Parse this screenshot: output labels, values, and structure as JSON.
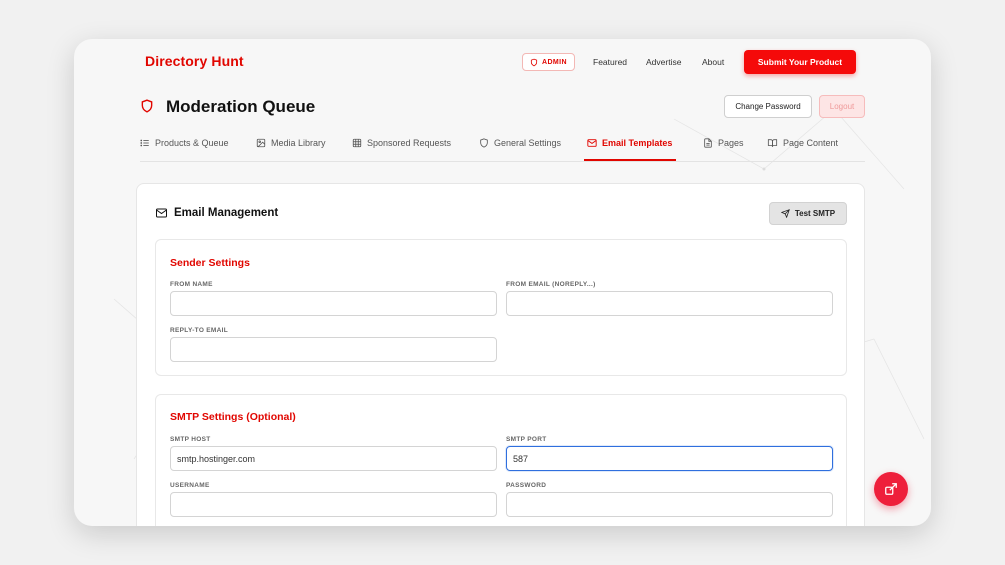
{
  "brand": "Directory Hunt",
  "nav": {
    "admin_badge": "ADMIN",
    "links": [
      "Featured",
      "Advertise",
      "About"
    ],
    "cta": "Submit Your Product"
  },
  "page": {
    "title": "Moderation Queue",
    "change_password": "Change Password",
    "logout": "Logout"
  },
  "tabs": [
    {
      "label": "Products & Queue",
      "icon": "list-icon"
    },
    {
      "label": "Media Library",
      "icon": "image-icon"
    },
    {
      "label": "Sponsored Requests",
      "icon": "grid-icon"
    },
    {
      "label": "General Settings",
      "icon": "shield-icon"
    },
    {
      "label": "Email Templates",
      "icon": "mail-icon",
      "active": true
    },
    {
      "label": "Pages",
      "icon": "file-icon"
    },
    {
      "label": "Page Content",
      "icon": "book-icon"
    }
  ],
  "card": {
    "title": "Email Management",
    "test_button": "Test SMTP",
    "sender": {
      "title": "Sender Settings",
      "from_name_label": "FROM NAME",
      "from_name_value": "",
      "from_email_label": "FROM EMAIL (NOREPLY...)",
      "from_email_value": "",
      "reply_to_label": "REPLY-TO EMAIL",
      "reply_to_value": ""
    },
    "smtp": {
      "title": "SMTP Settings (Optional)",
      "host_label": "SMTP HOST",
      "host_value": "smtp.hostinger.com",
      "port_label": "SMTP PORT",
      "port_value": "587",
      "username_label": "USERNAME",
      "username_value": "",
      "password_label": "PASSWORD",
      "password_value": ""
    }
  },
  "colors": {
    "accent": "#e10600",
    "cta": "#f50a0a",
    "focus": "#2f6fde",
    "fab": "#ee1f3b"
  }
}
